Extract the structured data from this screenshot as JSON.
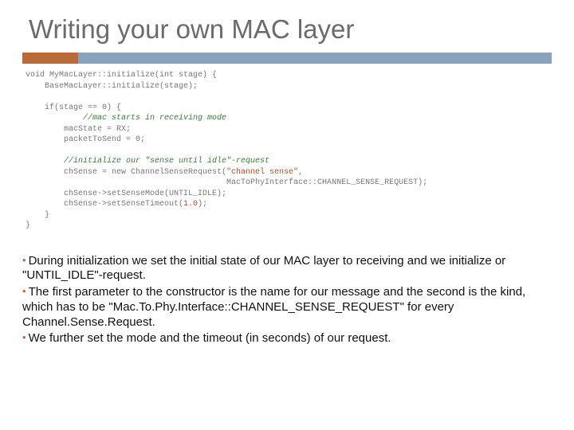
{
  "title": "Writing your own MAC layer",
  "code": {
    "l1a": "void MyMacLayer::initialize(int stage) {",
    "l2a": "    BaseMacLayer::initialize(stage);",
    "blank1": " ",
    "l3a": "    if(stage == 0) {",
    "l4c": "            //mac starts in receiving mode",
    "l5a": "        macState = RX;",
    "l6a": "        packetToSend = 0;",
    "blank2": " ",
    "l7c": "        //initialize our \"sense until idle\"-request",
    "l8a": "        chSense = new ChannelSenseRequest(",
    "l8s1": "\"channel sense\"",
    "l8b": ",",
    "l9a": "                                          MacToPhyInterface::CHANNEL_SENSE_REQUEST);",
    "l10a": "        chSense->setSenseMode(UNTIL_IDLE);",
    "l11a": "        chSense->setSenseTimeout(",
    "l11n": "1.0",
    "l11b": ");",
    "l12a": "    }",
    "l13a": "}"
  },
  "bullets": {
    "b1": "During initialization we set the initial state of our MAC layer to receiving and we initialize or \"UNTIL_IDLE\"-request.",
    "b2": "The first parameter to the constructor is the name for our message and the second is the kind, which has to be \"Mac.To.Phy.Interface::CHANNEL_SENSE_REQUEST\" for every Channel.Sense.Request.",
    "b3": "We further set the mode and the timeout (in seconds) of our request."
  }
}
